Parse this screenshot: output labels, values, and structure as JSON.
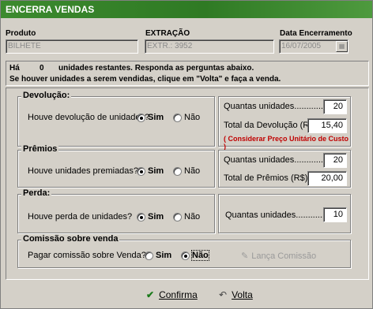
{
  "window": {
    "title": "ENCERRA VENDAS"
  },
  "header": {
    "produto_label": "Produto",
    "produto_value": "BILHETE",
    "extracao_label": "EXTRAÇÃO",
    "extracao_value": "EXTR.: 3952",
    "data_label": "Data Encerramento",
    "data_value": "16/07/2005"
  },
  "info": {
    "prefix": "Há",
    "count": "0",
    "line1": "unidades restantes. Responda as perguntas abaixo.",
    "line2": "Se houver unidades a serem vendidas, clique em \"Volta\" e faça a venda."
  },
  "devolucao": {
    "title": "Devolução:",
    "question": "Houve devolução de unidades?",
    "sim": "Sim",
    "nao": "Não",
    "selected": "Sim",
    "qtd_label": "Quantas unidades..................",
    "qtd_value": "20",
    "total_label": "Total da Devolução (R$):",
    "total_value": "15,40",
    "note": "( Considerar Preço Unitário de Custo )"
  },
  "premios": {
    "title": "Prêmios",
    "question": "Houve unidades premiadas?",
    "sim": "Sim",
    "nao": "Não",
    "selected": "Sim",
    "qtd_label": "Quantas unidades..............",
    "qtd_value": "20",
    "total_label": "Total de Prêmios (R$)...:",
    "total_value": "20,00"
  },
  "perda": {
    "title": "Perda:",
    "question": "Houve perda de unidades?",
    "sim": "Sim",
    "nao": "Não",
    "selected": "Sim",
    "qtd_label": "Quantas unidades..............",
    "qtd_value": "10"
  },
  "comissao": {
    "title": "Comissão sobre venda",
    "question": "Pagar comissão sobre Venda?",
    "sim": "Sim",
    "nao": "Não",
    "selected": "Não",
    "lanca_label": "Lança Comissão"
  },
  "buttons": {
    "confirma": "Confirma",
    "volta": "Volta"
  },
  "colors": {
    "title_bg": "#2f7a24",
    "window_bg": "#d4d0c8",
    "note": "#c00000"
  }
}
